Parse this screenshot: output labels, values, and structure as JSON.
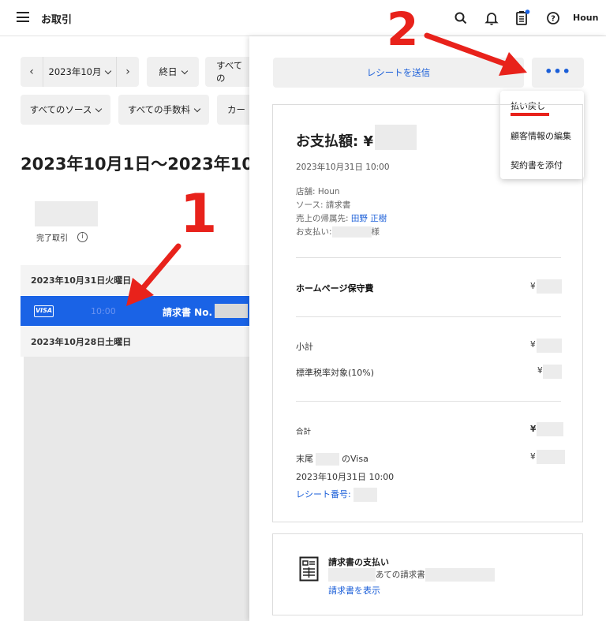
{
  "header": {
    "title": "お取引",
    "user": "Houn"
  },
  "filters": {
    "month": "2023年10月",
    "range": "終日",
    "all_cut": "すべての",
    "source": "すべてのソース",
    "fees": "すべての手数料",
    "card_cut": "カー"
  },
  "summary": {
    "heading": "2023年10月1日〜2023年10,",
    "completed_label": "完了取引",
    "info": "i"
  },
  "list": {
    "date1": "2023年10月31日火曜日",
    "date2": "2023年10月28日土曜日",
    "tx": {
      "brand": "VISA",
      "time": "10:00",
      "desc": "請求書 No."
    }
  },
  "panel": {
    "send_receipt": "レシートを送信",
    "more": "•••",
    "menu": [
      "払い戻し",
      "顧客情報の編集",
      "契約書を添付"
    ],
    "amount_label": "お支払額: ¥",
    "date": "2023年10月31日 10:00",
    "store": "店舗: Houn",
    "source": "ソース: 請求書",
    "assignee_label": "売上の帰属先: ",
    "assignee": "田野 正樹",
    "payer_prefix": "お支払い:",
    "payer_suffix": "様",
    "item_name": "ホームページ保守費",
    "yen": "¥",
    "subtotal": "小計",
    "tax": "標準税率対象(10%)",
    "total": "合計",
    "card_prefix": "末尾",
    "card_suffix": "のVisa",
    "pay_date": "2023年10月31日 10:00",
    "receipt_no": "レシート番号:"
  },
  "invoice": {
    "title": "請求書の支払い",
    "addressed": "あての請求書",
    "view_link": "請求書を表示"
  },
  "annotations": {
    "step1": "1",
    "step2": "2",
    "color": "#e8221b"
  }
}
